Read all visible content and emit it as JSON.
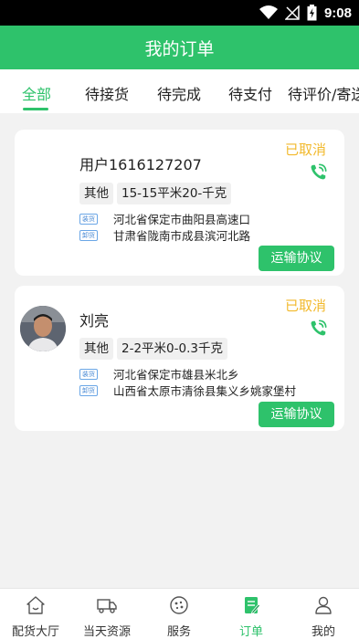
{
  "status_bar": {
    "time": "9:08"
  },
  "header": {
    "title": "我的订单"
  },
  "tabs": [
    {
      "label": "全部"
    },
    {
      "label": "待接货"
    },
    {
      "label": "待完成"
    },
    {
      "label": "待支付"
    },
    {
      "label": "待评价/寄送"
    }
  ],
  "orders": [
    {
      "user": "用户1616127207",
      "status": "已取消",
      "cargo_type": "其他",
      "spec": "15-15平米20-千克",
      "pickup_badge": "装货",
      "pickup": "河北省保定市曲阳县高速口",
      "dropoff_badge": "卸货",
      "dropoff": "甘肃省陇南市成县滨河北路",
      "button": "运输协议"
    },
    {
      "user": "刘亮",
      "status": "已取消",
      "cargo_type": "其他",
      "spec": "2-2平米0-0.3千克",
      "pickup_badge": "装货",
      "pickup": "河北省保定市雄县米北乡",
      "dropoff_badge": "卸货",
      "dropoff": "山西省太原市清徐县集义乡姚家堡村",
      "button": "运输协议"
    }
  ],
  "bottom_nav": [
    {
      "label": "配货大厅",
      "icon": "home-icon"
    },
    {
      "label": "当天资源",
      "icon": "truck-icon"
    },
    {
      "label": "服务",
      "icon": "service-icon"
    },
    {
      "label": "订单",
      "icon": "order-icon"
    },
    {
      "label": "我的",
      "icon": "user-icon"
    }
  ],
  "colors": {
    "primary": "#2ec26b",
    "status_cancelled": "#f2b92c",
    "badge_blue": "#4a8ad4"
  }
}
